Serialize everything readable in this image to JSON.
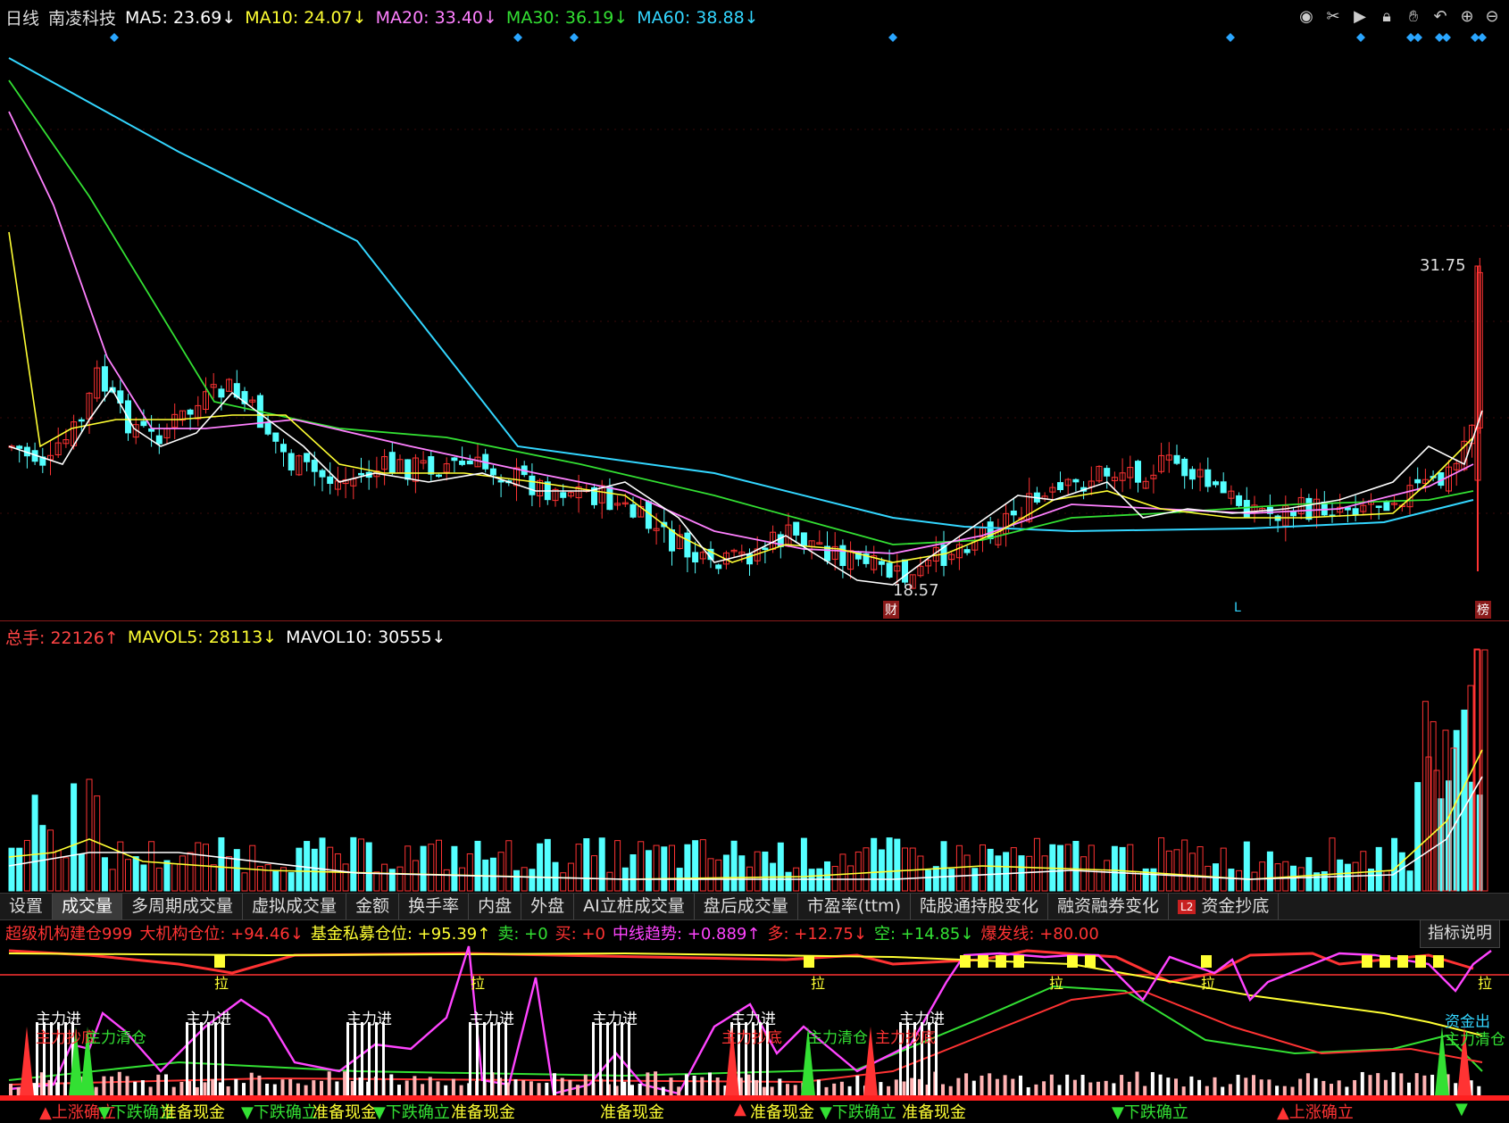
{
  "header": {
    "period": "日线",
    "stock": "南凌科技",
    "ma": [
      {
        "label": "MA5: 23.69↓",
        "color": "#ffffff"
      },
      {
        "label": "MA10: 24.07↓",
        "color": "#ffff33"
      },
      {
        "label": "MA20: 33.40↓",
        "color": "#ff80ff"
      },
      {
        "label": "MA30: 36.19↓",
        "color": "#33e033"
      },
      {
        "label": "MA60: 38.88↓",
        "color": "#33d6ff"
      }
    ]
  },
  "toolbar_icons": [
    "eye-icon",
    "scissors-icon",
    "play-icon",
    "lock-icon",
    "hand-icon",
    "undo-icon",
    "zoom-in-icon",
    "zoom-out-icon"
  ],
  "price_panel": {
    "high_label": "31.75",
    "low_label": "18.57",
    "marker_cai": "财",
    "marker_bang": "榜",
    "marker_L": "L"
  },
  "volume_panel": {
    "items": [
      {
        "label": "总手: 22126↑",
        "color": "#ff4444"
      },
      {
        "label": "MAVOL5: 28113↓",
        "color": "#ffff33"
      },
      {
        "label": "MAVOL10: 30555↓",
        "color": "#ffffff"
      }
    ]
  },
  "tabs": [
    {
      "label": "设置",
      "active": false
    },
    {
      "label": "成交量",
      "active": true
    },
    {
      "label": "多周期成交量",
      "active": false
    },
    {
      "label": "虚拟成交量",
      "active": false
    },
    {
      "label": "金额",
      "active": false
    },
    {
      "label": "换手率",
      "active": false
    },
    {
      "label": "内盘",
      "active": false
    },
    {
      "label": "外盘",
      "active": false
    },
    {
      "label": "AI立桩成交量",
      "active": false
    },
    {
      "label": "盘后成交量",
      "active": false
    },
    {
      "label": "市盈率(ttm)",
      "active": false
    },
    {
      "label": "陆股通持股变化",
      "active": false
    },
    {
      "label": "融资融券变化",
      "active": false
    },
    {
      "label": "资金抄底",
      "active": false,
      "badge": "L2"
    }
  ],
  "indicator_panel": {
    "items": [
      {
        "label": "超级机构建仓999",
        "color": "#ff3333"
      },
      {
        "label": "大机构仓位: +94.46↓",
        "color": "#ff3333"
      },
      {
        "label": "基金私募仓位: +95.39↑",
        "color": "#ffff33"
      },
      {
        "label": "卖: +0",
        "color": "#33e033"
      },
      {
        "label": "买: +0",
        "color": "#ff3333"
      },
      {
        "label": "中线趋势: +0.889↑",
        "color": "#ff44ff"
      },
      {
        "label": "多: +12.75↓",
        "color": "#ff3333"
      },
      {
        "label": "空: +14.85↓",
        "color": "#33e033"
      },
      {
        "label": "爆发线: +80.00",
        "color": "#ff3333"
      }
    ],
    "explain_button": "指标说明",
    "label_lift": "拉",
    "label_main_in": "主力进",
    "label_main_clear": "主力清仓",
    "label_main_bottom": "主力抄底",
    "label_cash": "准备现金",
    "label_down": "▼下跌确立",
    "label_up": "▲上涨确立",
    "label_fund_out": "资金出",
    "label_clear": "主力清仓"
  },
  "colors": {
    "up": "#ff3333",
    "down": "#54ffff",
    "ma5": "#ffffff",
    "ma10": "#ffff33",
    "ma20": "#ff80ff",
    "ma30": "#33e033",
    "ma60": "#33d6ff"
  }
}
